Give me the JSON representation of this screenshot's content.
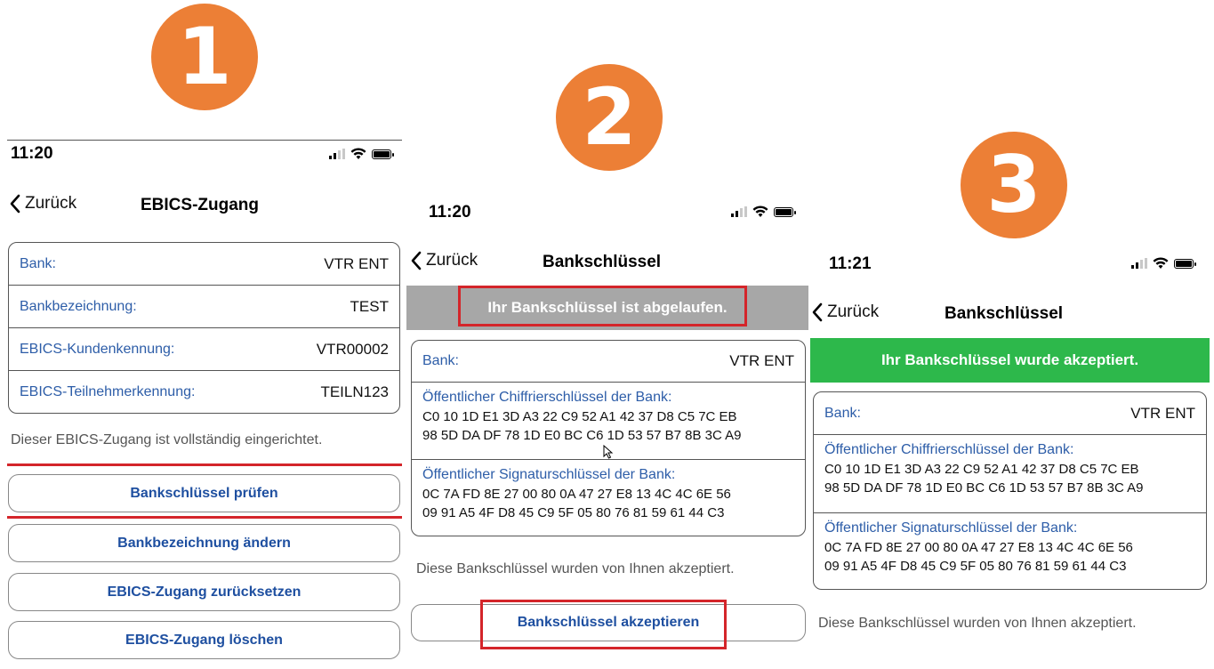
{
  "steps": {
    "one": "1",
    "two": "2",
    "three": "3"
  },
  "colors": {
    "badge": "#ec7f36",
    "link": "#1e4fa0",
    "label": "#2d5da8",
    "error": "#d4252a",
    "expired_banner": "#a7a7a7",
    "accepted_banner": "#2db84b"
  },
  "screen1": {
    "time": "11:20",
    "back": "Zurück",
    "title": "EBICS-Zugang",
    "rows": [
      {
        "label": "Bank:",
        "value": "VTR ENT"
      },
      {
        "label": "Bankbezeichnung:",
        "value": "TEST"
      },
      {
        "label": "EBICS-Kundenkennung:",
        "value": "VTR00002"
      },
      {
        "label": "EBICS-Teilnehmerkennung:",
        "value": "TEILN123"
      }
    ],
    "info": "Dieser EBICS-Zugang ist vollständig eingerichtet.",
    "buttons": [
      "Bankschlüssel prüfen",
      "Bankbezeichnung ändern",
      "EBICS-Zugang zurücksetzen",
      "EBICS-Zugang löschen"
    ]
  },
  "screen2": {
    "time": "11:20",
    "back": "Zurück",
    "title": "Bankschlüssel",
    "banner": "Ihr Bankschlüssel ist abgelaufen.",
    "bank_label": "Bank:",
    "bank_value": "VTR ENT",
    "cipher_label": "Öffentlicher Chiffrierschlüssel der Bank:",
    "cipher_line1": "C0 10 1D E1 3D A3 22 C9 52 A1 42 37 D8 C5 7C EB",
    "cipher_line2": "98 5D DA DF 78 1D E0 BC C6 1D 53 57 B7 8B 3C A9",
    "sign_label": "Öffentlicher Signaturschlüssel der Bank:",
    "sign_line1": "0C 7A FD 8E 27 00 80 0A 47 27 E8 13 4C 4C 6E 56",
    "sign_line2": "09 91 A5 4F D8 45 C9 5F 05 80 76 81 59 61 44 C3",
    "info": "Diese Bankschlüssel wurden von Ihnen akzeptiert.",
    "button": "Bankschlüssel akzeptieren"
  },
  "screen3": {
    "time": "11:21",
    "back": "Zurück",
    "title": "Bankschlüssel",
    "banner": "Ihr Bankschlüssel wurde akzeptiert.",
    "bank_label": "Bank:",
    "bank_value": "VTR ENT",
    "cipher_label": "Öffentlicher Chiffrierschlüssel der Bank:",
    "cipher_line1": "C0 10 1D E1 3D A3 22 C9 52 A1 42 37 D8 C5 7C EB",
    "cipher_line2": "98 5D DA DF 78 1D E0 BC C6 1D 53 57 B7 8B 3C A9",
    "sign_label": "Öffentlicher Signaturschlüssel der Bank:",
    "sign_line1": "0C 7A FD 8E 27 00 80 0A 47 27 E8 13 4C 4C 6E 56",
    "sign_line2": "09 91 A5 4F D8 45 C9 5F 05 80 76 81 59 61 44 C3",
    "info": "Diese Bankschlüssel wurden von Ihnen akzeptiert."
  }
}
